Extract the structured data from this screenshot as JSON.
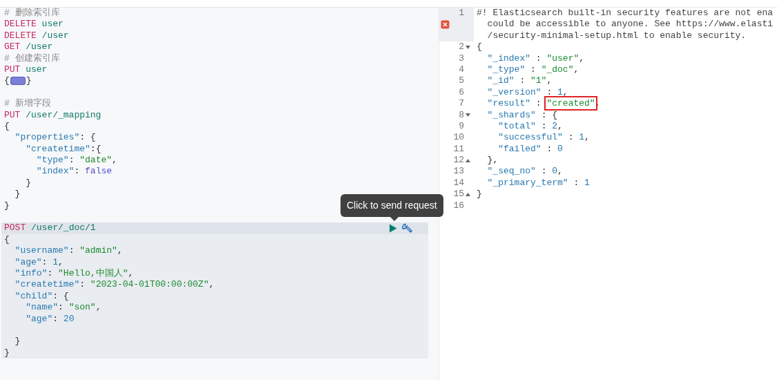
{
  "request_editor": {
    "blocks": [
      {
        "selected": false,
        "lines": [
          {
            "kind": "code",
            "tokens": [
              {
                "kind": "comment",
                "text": "# 删除索引库"
              }
            ]
          },
          {
            "kind": "code",
            "tokens": [
              {
                "kind": "method",
                "text": "DELETE"
              },
              {
                "kind": "path",
                "text": " user"
              }
            ]
          },
          {
            "kind": "code",
            "tokens": [
              {
                "kind": "method",
                "text": "DELETE"
              },
              {
                "kind": "path",
                "text": " /user"
              }
            ]
          },
          {
            "kind": "code",
            "tokens": [
              {
                "kind": "method",
                "text": "GET"
              },
              {
                "kind": "path",
                "text": " /user"
              }
            ]
          },
          {
            "kind": "code",
            "tokens": [
              {
                "kind": "comment",
                "text": "# 创建索引库"
              }
            ]
          },
          {
            "kind": "code",
            "tokens": [
              {
                "kind": "method",
                "text": "PUT"
              },
              {
                "kind": "path",
                "text": " user"
              }
            ]
          },
          {
            "kind": "code",
            "tokens": [
              {
                "kind": "punct",
                "text": "{"
              },
              {
                "kind": "fold"
              },
              {
                "kind": "punct",
                "text": "}"
              }
            ]
          },
          {
            "kind": "blank"
          },
          {
            "kind": "code",
            "tokens": [
              {
                "kind": "comment",
                "text": "# 新增字段"
              }
            ]
          },
          {
            "kind": "code",
            "tokens": [
              {
                "kind": "method",
                "text": "PUT"
              },
              {
                "kind": "path",
                "text": " /user/_mapping"
              }
            ]
          },
          {
            "kind": "code",
            "tokens": [
              {
                "kind": "punct",
                "text": "{"
              }
            ]
          },
          {
            "kind": "code",
            "tokens": [
              {
                "kind": "key",
                "text": "  \"properties\""
              },
              {
                "kind": "punct",
                "text": ": {"
              }
            ]
          },
          {
            "kind": "code",
            "tokens": [
              {
                "kind": "key",
                "text": "    \"createtime\""
              },
              {
                "kind": "punct",
                "text": ":{"
              }
            ]
          },
          {
            "kind": "code",
            "tokens": [
              {
                "kind": "key",
                "text": "      \"type\""
              },
              {
                "kind": "punct",
                "text": ": "
              },
              {
                "kind": "string",
                "text": "\"date\""
              },
              {
                "kind": "punct",
                "text": ","
              }
            ]
          },
          {
            "kind": "code",
            "tokens": [
              {
                "kind": "key",
                "text": "      \"index\""
              },
              {
                "kind": "punct",
                "text": ": "
              },
              {
                "kind": "keyword",
                "text": "false"
              }
            ]
          },
          {
            "kind": "code",
            "tokens": [
              {
                "kind": "punct",
                "text": "    }"
              }
            ]
          },
          {
            "kind": "code",
            "tokens": [
              {
                "kind": "punct",
                "text": "  }"
              }
            ]
          },
          {
            "kind": "code",
            "tokens": [
              {
                "kind": "punct",
                "text": "}"
              }
            ]
          },
          {
            "kind": "blank"
          }
        ]
      },
      {
        "selected": true,
        "lines": [
          {
            "kind": "code",
            "tokens": [
              {
                "kind": "method",
                "text": "POST"
              },
              {
                "kind": "path",
                "text": " /user/_doc/1"
              }
            ]
          },
          {
            "kind": "code",
            "tokens": [
              {
                "kind": "punct",
                "text": "{"
              }
            ]
          },
          {
            "kind": "code",
            "tokens": [
              {
                "kind": "key",
                "text": "  \"username\""
              },
              {
                "kind": "punct",
                "text": ": "
              },
              {
                "kind": "string",
                "text": "\"admin\""
              },
              {
                "kind": "punct",
                "text": ","
              }
            ]
          },
          {
            "kind": "code",
            "tokens": [
              {
                "kind": "key",
                "text": "  \"age\""
              },
              {
                "kind": "punct",
                "text": ": "
              },
              {
                "kind": "number",
                "text": "1"
              },
              {
                "kind": "punct",
                "text": ","
              }
            ]
          },
          {
            "kind": "code",
            "tokens": [
              {
                "kind": "key",
                "text": "  \"info\""
              },
              {
                "kind": "punct",
                "text": ": "
              },
              {
                "kind": "string",
                "text": "\"Hello,中国人\""
              },
              {
                "kind": "punct",
                "text": ","
              }
            ]
          },
          {
            "kind": "code",
            "tokens": [
              {
                "kind": "key",
                "text": "  \"createtime\""
              },
              {
                "kind": "punct",
                "text": ": "
              },
              {
                "kind": "string",
                "text": "\"2023-04-01T00:00:00Z\""
              },
              {
                "kind": "punct",
                "text": ","
              }
            ]
          },
          {
            "kind": "code",
            "tokens": [
              {
                "kind": "key",
                "text": "  \"child\""
              },
              {
                "kind": "punct",
                "text": ": {"
              }
            ]
          },
          {
            "kind": "code",
            "tokens": [
              {
                "kind": "key",
                "text": "    \"name\""
              },
              {
                "kind": "punct",
                "text": ": "
              },
              {
                "kind": "string",
                "text": "\"son\""
              },
              {
                "kind": "punct",
                "text": ","
              }
            ]
          },
          {
            "kind": "code",
            "tokens": [
              {
                "kind": "key",
                "text": "    \"age\""
              },
              {
                "kind": "punct",
                "text": ": "
              },
              {
                "kind": "number",
                "text": "20"
              }
            ]
          },
          {
            "kind": "blank"
          },
          {
            "kind": "code",
            "tokens": [
              {
                "kind": "punct",
                "text": "  }"
              }
            ]
          },
          {
            "kind": "code",
            "tokens": [
              {
                "kind": "punct",
                "text": "}"
              }
            ]
          }
        ]
      }
    ]
  },
  "request_actions": {
    "tooltip": "Click to send request"
  },
  "response": {
    "lines": [
      {
        "number": "1",
        "fold_open": false,
        "fold_close": false,
        "error": true,
        "rows": [
          [
            {
              "kind": "warning",
              "text": "#! Elasticsearch built-in security features are not ena"
            }
          ],
          [
            {
              "kind": "warning",
              "text": "  could be accessible to anyone. See https://www.elasti"
            }
          ],
          [
            {
              "kind": "warning",
              "text": "  /security-minimal-setup.html to enable security."
            }
          ]
        ]
      },
      {
        "number": "2",
        "fold_open": true,
        "fold_close": false,
        "error": false,
        "rows": [
          [
            {
              "kind": "punct",
              "text": "{"
            }
          ]
        ]
      },
      {
        "number": "3",
        "fold_open": false,
        "fold_close": false,
        "error": false,
        "rows": [
          [
            {
              "kind": "key",
              "text": "  \"_index\""
            },
            {
              "kind": "punct",
              "text": " : "
            },
            {
              "kind": "string",
              "text": "\"user\""
            },
            {
              "kind": "punct",
              "text": ","
            }
          ]
        ]
      },
      {
        "number": "4",
        "fold_open": false,
        "fold_close": false,
        "error": false,
        "rows": [
          [
            {
              "kind": "key",
              "text": "  \"_type\""
            },
            {
              "kind": "punct",
              "text": " : "
            },
            {
              "kind": "string",
              "text": "\"_doc\""
            },
            {
              "kind": "punct",
              "text": ","
            }
          ]
        ]
      },
      {
        "number": "5",
        "fold_open": false,
        "fold_close": false,
        "error": false,
        "rows": [
          [
            {
              "kind": "key",
              "text": "  \"_id\""
            },
            {
              "kind": "punct",
              "text": " : "
            },
            {
              "kind": "string",
              "text": "\"1\""
            },
            {
              "kind": "punct",
              "text": ","
            }
          ]
        ]
      },
      {
        "number": "6",
        "fold_open": false,
        "fold_close": false,
        "error": false,
        "rows": [
          [
            {
              "kind": "key",
              "text": "  \"_version\""
            },
            {
              "kind": "punct",
              "text": " : "
            },
            {
              "kind": "number",
              "text": "1"
            },
            {
              "kind": "punct",
              "text": ","
            }
          ]
        ]
      },
      {
        "number": "7",
        "fold_open": false,
        "fold_close": false,
        "error": false,
        "rows": [
          [
            {
              "kind": "key",
              "text": "  \"result\""
            },
            {
              "kind": "punct",
              "text": " : "
            },
            {
              "kind": "string",
              "text": "\"created\"",
              "boxed": true
            },
            {
              "kind": "punct",
              "text": ","
            }
          ]
        ]
      },
      {
        "number": "8",
        "fold_open": true,
        "fold_close": false,
        "error": false,
        "rows": [
          [
            {
              "kind": "key",
              "text": "  \"_shards\""
            },
            {
              "kind": "punct",
              "text": " : {"
            }
          ]
        ]
      },
      {
        "number": "9",
        "fold_open": false,
        "fold_close": false,
        "error": false,
        "rows": [
          [
            {
              "kind": "key",
              "text": "    \"total\""
            },
            {
              "kind": "punct",
              "text": " : "
            },
            {
              "kind": "number",
              "text": "2"
            },
            {
              "kind": "punct",
              "text": ","
            }
          ]
        ]
      },
      {
        "number": "10",
        "fold_open": false,
        "fold_close": false,
        "error": false,
        "rows": [
          [
            {
              "kind": "key",
              "text": "    \"successful\""
            },
            {
              "kind": "punct",
              "text": " : "
            },
            {
              "kind": "number",
              "text": "1"
            },
            {
              "kind": "punct",
              "text": ","
            }
          ]
        ]
      },
      {
        "number": "11",
        "fold_open": false,
        "fold_close": false,
        "error": false,
        "rows": [
          [
            {
              "kind": "key",
              "text": "    \"failed\""
            },
            {
              "kind": "punct",
              "text": " : "
            },
            {
              "kind": "number",
              "text": "0"
            }
          ]
        ]
      },
      {
        "number": "12",
        "fold_open": false,
        "fold_close": true,
        "error": false,
        "rows": [
          [
            {
              "kind": "punct",
              "text": "  },"
            }
          ]
        ]
      },
      {
        "number": "13",
        "fold_open": false,
        "fold_close": false,
        "error": false,
        "rows": [
          [
            {
              "kind": "key",
              "text": "  \"_seq_no\""
            },
            {
              "kind": "punct",
              "text": " : "
            },
            {
              "kind": "number",
              "text": "0"
            },
            {
              "kind": "punct",
              "text": ","
            }
          ]
        ]
      },
      {
        "number": "14",
        "fold_open": false,
        "fold_close": false,
        "error": false,
        "rows": [
          [
            {
              "kind": "key",
              "text": "  \"_primary_term\""
            },
            {
              "kind": "punct",
              "text": " : "
            },
            {
              "kind": "number",
              "text": "1"
            }
          ]
        ]
      },
      {
        "number": "15",
        "fold_open": false,
        "fold_close": true,
        "error": false,
        "rows": [
          [
            {
              "kind": "punct",
              "text": "}"
            }
          ]
        ]
      },
      {
        "number": "16",
        "fold_open": false,
        "fold_close": false,
        "error": false
      }
    ]
  }
}
